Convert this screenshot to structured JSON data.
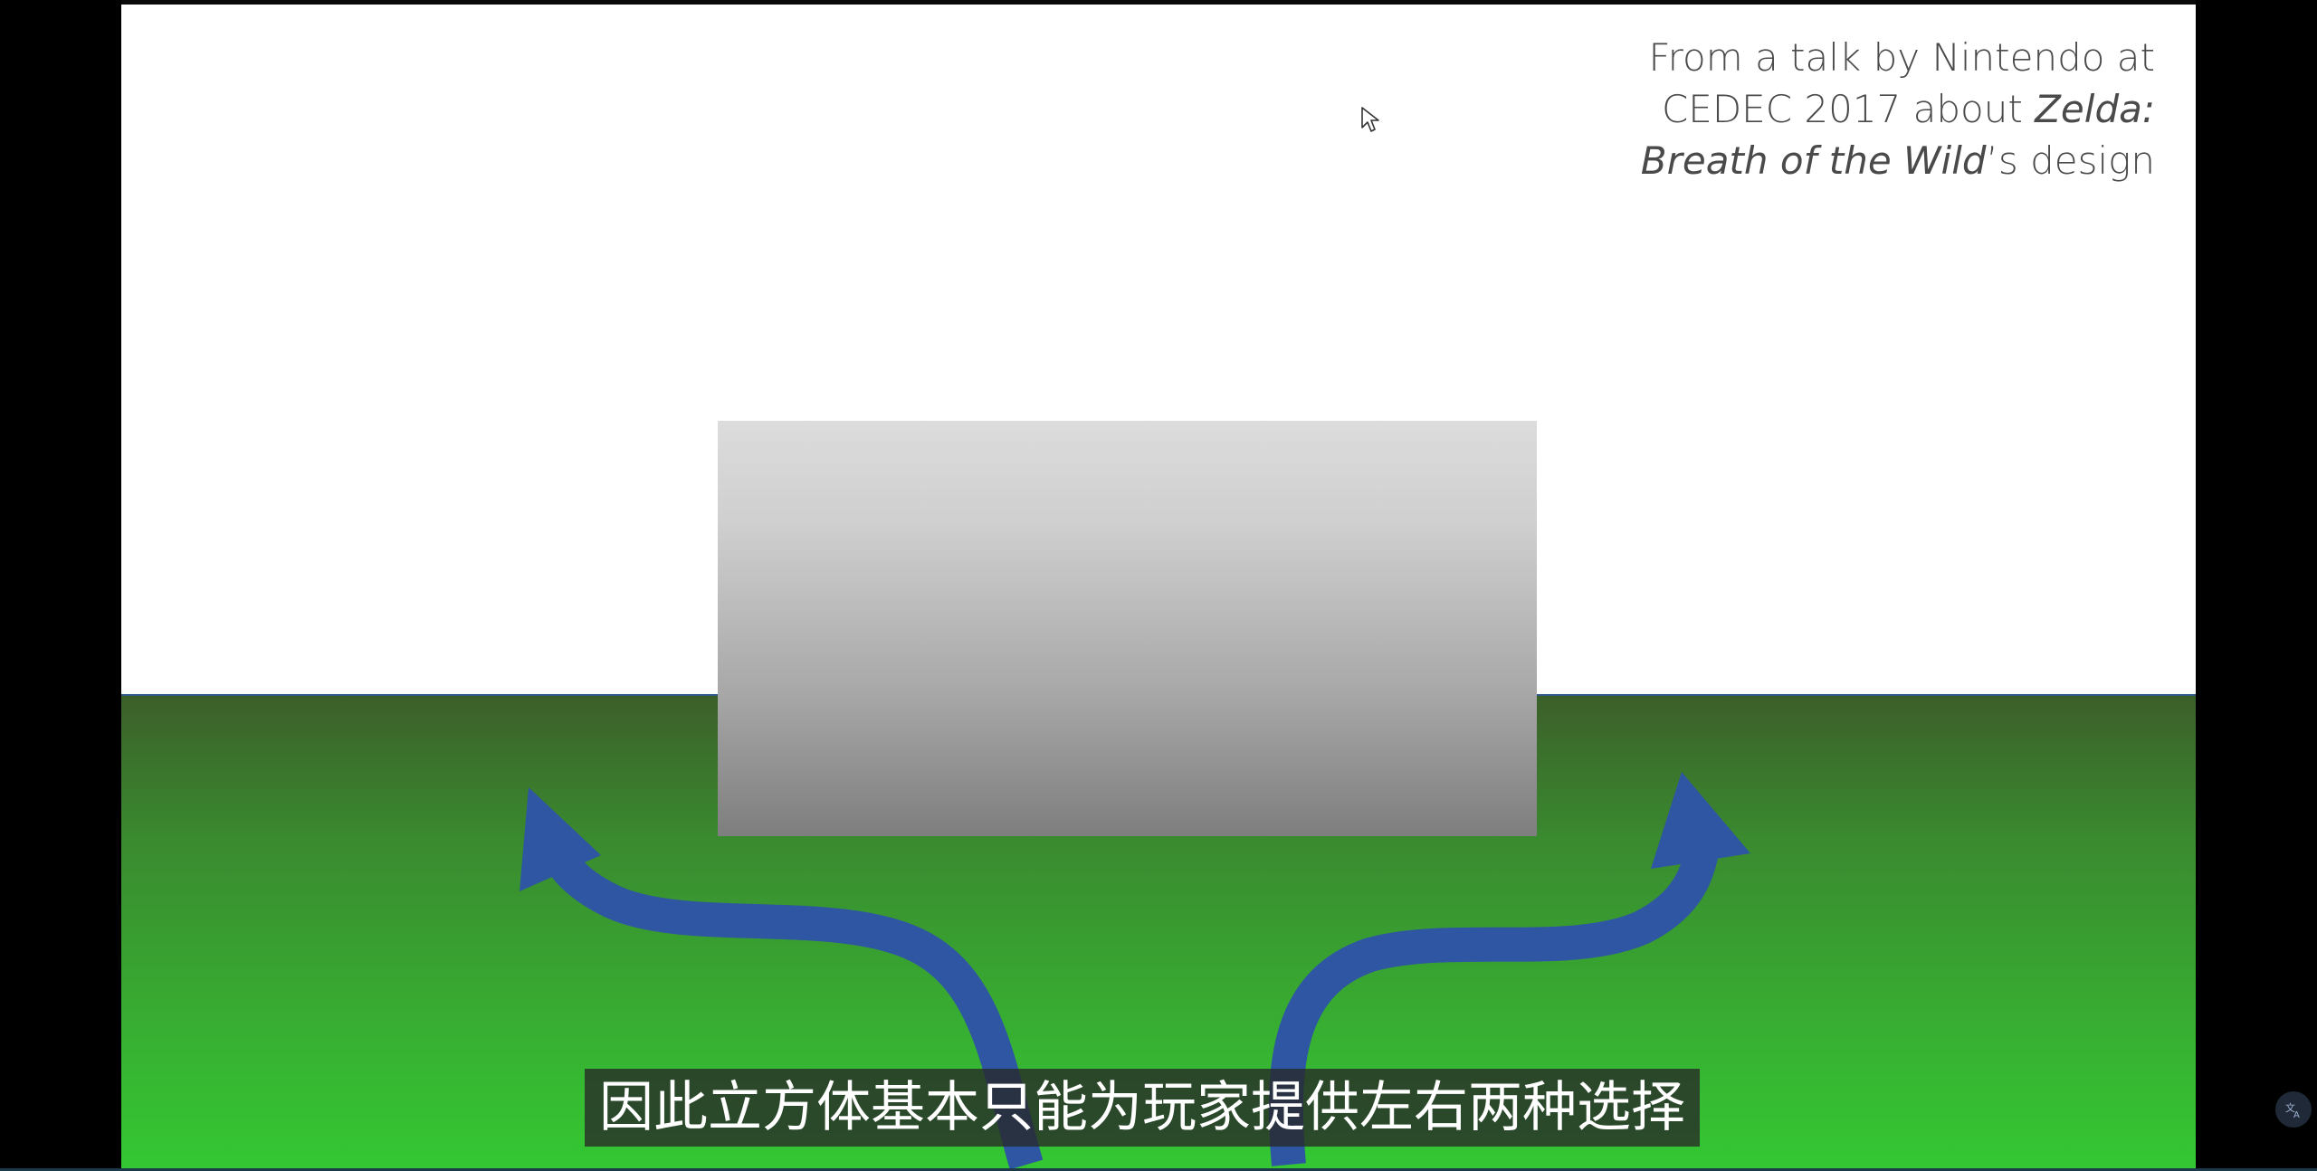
{
  "slide": {
    "caption": {
      "line1": "From a talk by Nintendo at",
      "line2_prefix": "CEDEC 2017 about ",
      "line2_italic": "Zelda:",
      "line3_italic": "Breath of the Wild",
      "line3_suffix": "’s design"
    },
    "colors": {
      "sky": "#ffffff",
      "ground_top": "#3c5f2a",
      "ground_bottom": "#34c833",
      "cube_top": "#dcdcdc",
      "cube_bottom": "#7e7e7e",
      "arrow": "#2f56a3"
    }
  },
  "subtitle": {
    "text": "因此立方体基本只能为玩家提供左右两种选择"
  },
  "icons": {
    "cursor": "mouse-pointer-icon",
    "translate": "translate-icon"
  }
}
